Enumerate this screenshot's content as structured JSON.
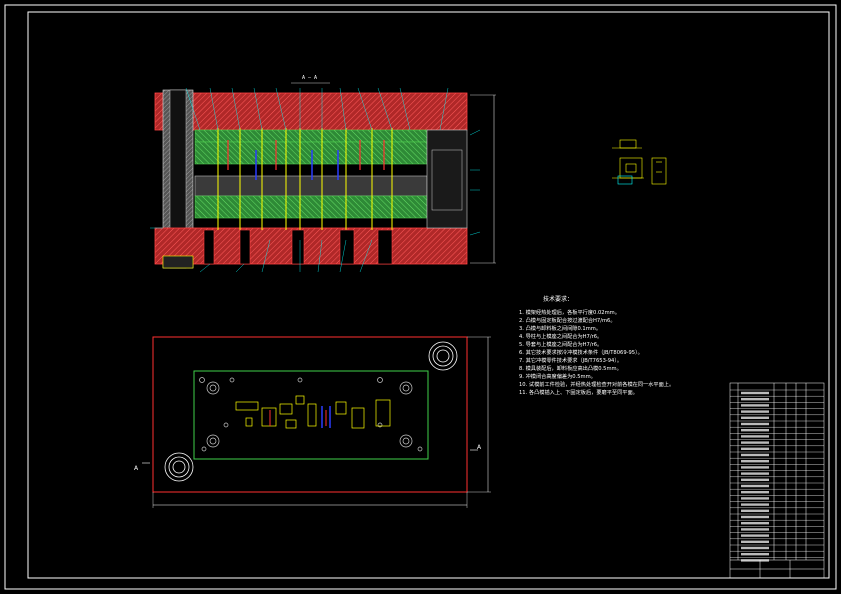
{
  "drawing": {
    "section_label": "A — A",
    "view_markers": [
      "A",
      "A"
    ],
    "technical_requirements": {
      "title": "技术要求：",
      "items": [
        "1. 模架经热处理后，各板平行度0.02mm。",
        "2. 凸模与固定板配合按过渡配合H7/m6。",
        "3. 凸模与卸料板之间间隙0.1mm。",
        "4. 导柱与上模座之间配合为H7/r6。",
        "5. 导套与上模座之间配合为H7/r6。",
        "6. 其它技术要求按冷冲模技术条件（JB/T8069-95）。",
        "7. 其它冲模零件技术要求（JB/T7653-94）。",
        "8. 模具装配后，卸料板应高出凸模0.5mm。",
        "9. 冲模闭合高度偏差为0.5mm。",
        "10. 试模前工件检验，并经热处理检查开对前各模在同一水平面上。",
        "11. 各凸模插入上、下固定板后，要磨平至同平面。"
      ]
    },
    "colors": {
      "background": "#000000",
      "frame": "#ffffff",
      "plate_red": "#d23a3a",
      "plate_green": "#3fb54a",
      "accent_yellow": "#ffff00",
      "accent_blue": "#2a3cff",
      "accent_cyan": "#00ffff"
    }
  }
}
